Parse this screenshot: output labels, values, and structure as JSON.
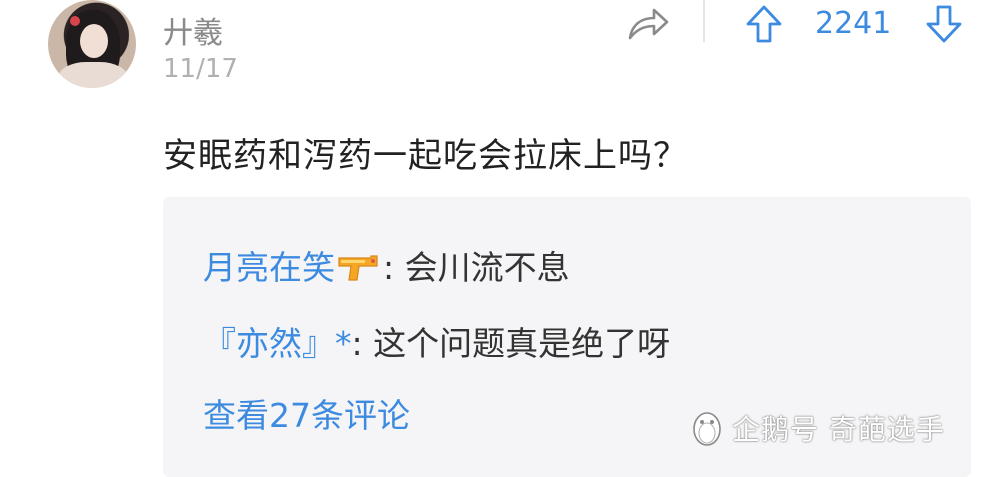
{
  "post": {
    "username": "廾羲",
    "date": "11/17",
    "vote_count": "2241",
    "question": "安眠药和泻药一起吃会拉床上吗？"
  },
  "replies": [
    {
      "name": "月亮在笑",
      "emoji": "water-pistol-icon",
      "separator": ":",
      "text": "会川流不息"
    },
    {
      "name": "『亦然』*",
      "separator": ":",
      "text": "这个问题真是绝了呀"
    }
  ],
  "more_comments": "查看27条评论",
  "watermark": "企鹅号 奇葩选手",
  "colors": {
    "accent": "#3d8be0",
    "box_bg": "#f5f5f7",
    "muted": "#8a8a8a"
  }
}
